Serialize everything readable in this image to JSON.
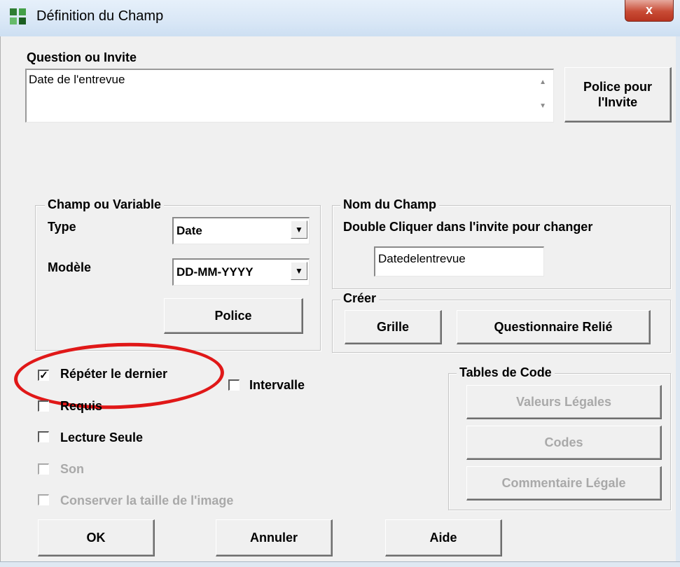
{
  "window": {
    "title": "Définition du Champ",
    "close_label": "x"
  },
  "prompt": {
    "label": "Question ou Invite",
    "value": "Date de l'entrevue",
    "font_button": "Police pour l'Invite",
    "font_button_line1": "Police pour",
    "font_button_line2": "l'Invite"
  },
  "field_group": {
    "title": "Champ ou Variable",
    "type_label": "Type",
    "type_value": "Date",
    "model_label": "Modèle",
    "model_value": "DD-MM-YYYY",
    "font_button": "Police"
  },
  "name_group": {
    "title": "Nom du Champ",
    "hint": "Double Cliquer dans l'invite pour changer",
    "value": "Datedelentrevue"
  },
  "create_group": {
    "title": "Créer",
    "grid_button": "Grille",
    "linked_button": "Questionnaire Relié"
  },
  "options": {
    "repeat_last": {
      "label": "Répéter le dernier",
      "checked": true
    },
    "interval": {
      "label": "Intervalle",
      "checked": false
    },
    "required": {
      "label": "Requis",
      "checked": false
    },
    "read_only": {
      "label": "Lecture Seule",
      "checked": false
    },
    "sound": {
      "label": "Son",
      "checked": false,
      "disabled": true
    },
    "keep_image_size": {
      "label": "Conserver la taille de l'image",
      "checked": false,
      "disabled": true
    }
  },
  "code_tables": {
    "title": "Tables de Code",
    "legal_values": "Valeurs Légales",
    "codes": "Codes",
    "legal_comment": "Commentaire Légale"
  },
  "footer": {
    "ok": "OK",
    "cancel": "Annuler",
    "help": "Aide"
  },
  "colors": {
    "annotation": "#e01818",
    "dialog_bg": "#f0f0f0",
    "title_bar": "#dbe8f6"
  },
  "icons": {
    "app": "app-icon",
    "close": "close-icon",
    "dropdown": "chevron-down-icon",
    "check": "checkmark-icon"
  }
}
